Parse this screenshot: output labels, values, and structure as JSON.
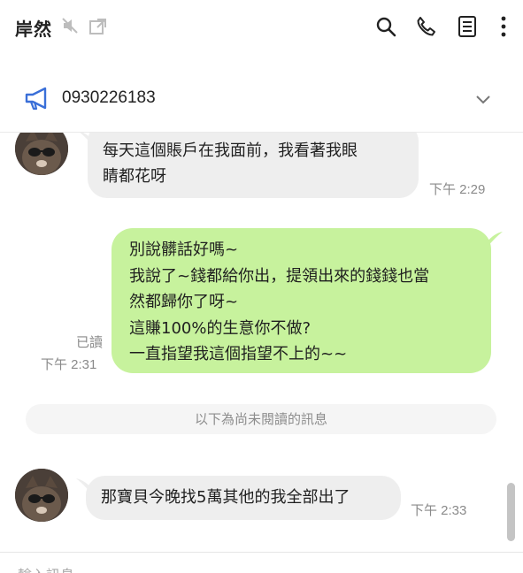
{
  "header": {
    "title": "岸然",
    "icons": {
      "mute": "mute-speaker-icon",
      "open_window": "open-window-icon",
      "search": "search-icon",
      "call": "phone-icon",
      "notes": "notes-icon",
      "more": "more-vertical-icon"
    }
  },
  "announcement": {
    "text": "0930226183",
    "icon": "megaphone-icon",
    "accent_color": "#3a6fd8"
  },
  "messages": [
    {
      "direction": "incoming",
      "lines": [
        "每天這個賬戶在我面前，我看著我眼",
        "睛都花呀"
      ],
      "time": "下午 2:29"
    },
    {
      "direction": "outgoing",
      "lines": [
        "別說髒話好嗎~",
        "我說了~錢都給你出，提領出來的錢錢也當",
        "然都歸你了呀~",
        "這賺100%的生意你不做?",
        "一直指望我這個指望不上的~~"
      ],
      "read": "已讀",
      "time": "下午 2:31"
    },
    {
      "direction": "incoming",
      "lines": [
        "那寶貝今晚找5萬其他的我全部出了"
      ],
      "time": "下午 2:33"
    }
  ],
  "unread_divider": "以下為尚未閱讀的訊息",
  "input": {
    "placeholder": "輸入訊息"
  },
  "colors": {
    "incoming_bubble": "#eeeeee",
    "outgoing_bubble": "#c7f29d"
  }
}
